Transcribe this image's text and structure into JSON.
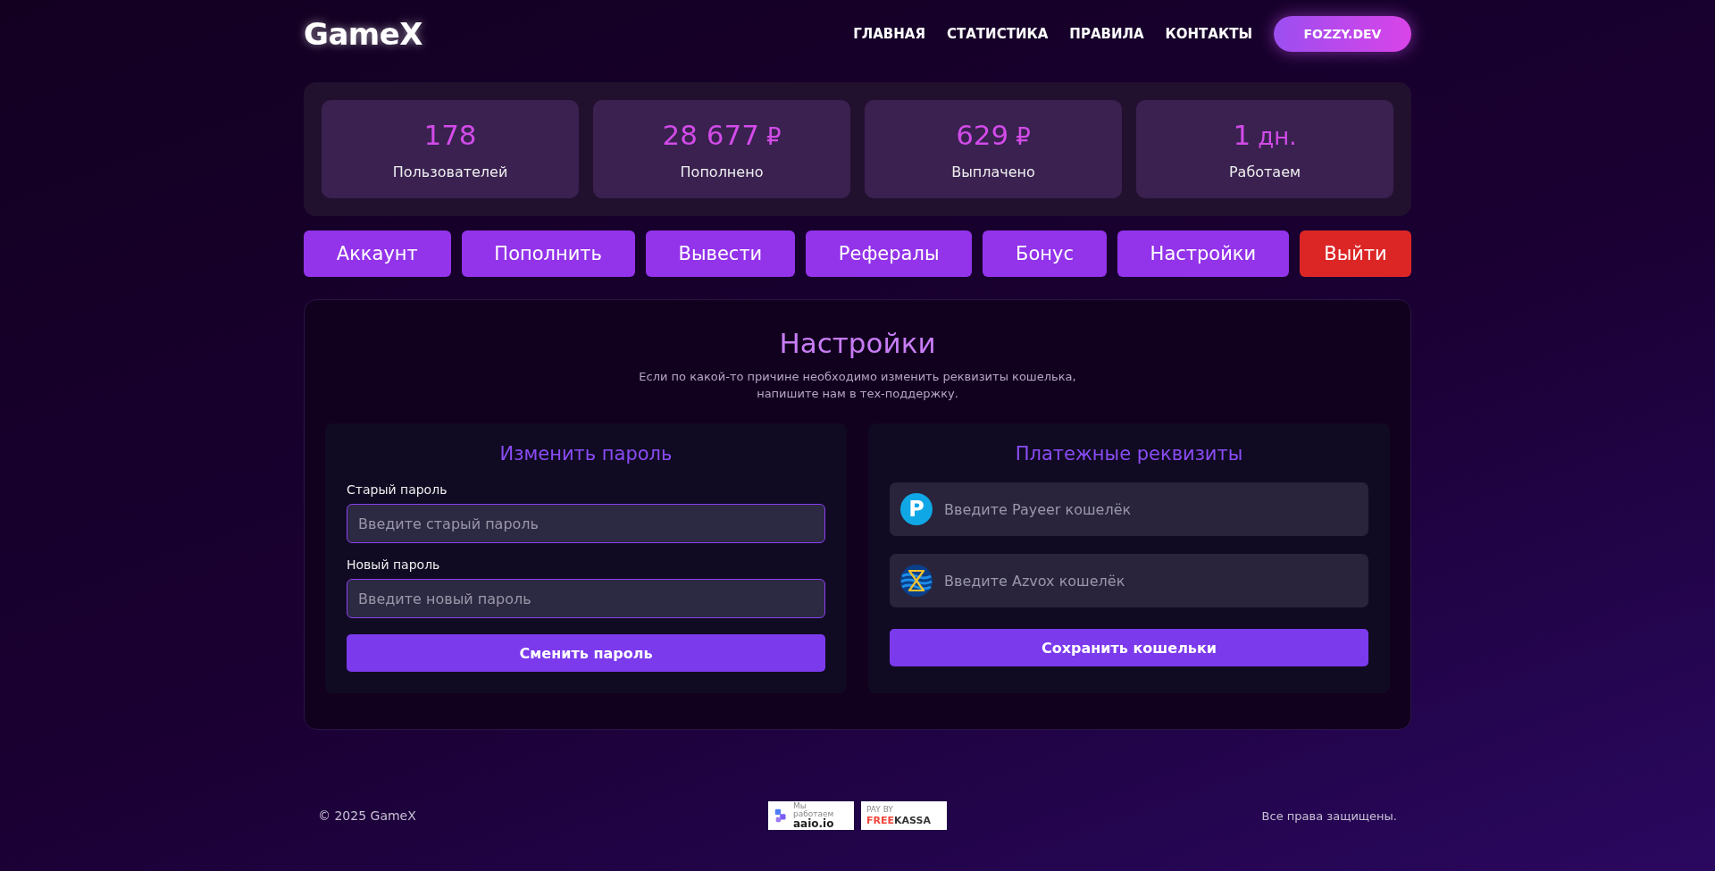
{
  "header": {
    "logo": "GameX",
    "nav": [
      "ГЛАВНАЯ",
      "СТАТИСТИКА",
      "ПРАВИЛА",
      "КОНТАКТЫ"
    ],
    "user_button": "FOZZY.DEV"
  },
  "stats": [
    {
      "value": "178",
      "label": "Пользователей"
    },
    {
      "value": "28 677",
      "unit": "₽",
      "label": "Пополнено"
    },
    {
      "value": "629",
      "unit": "₽",
      "label": "Выплачено"
    },
    {
      "value": "1",
      "unit": "дн.",
      "label": "Работаем"
    }
  ],
  "menu": [
    {
      "label": "Аккаунт",
      "kind": "normal"
    },
    {
      "label": "Пополнить",
      "kind": "normal"
    },
    {
      "label": "Вывести",
      "kind": "normal"
    },
    {
      "label": "Рефералы",
      "kind": "normal"
    },
    {
      "label": "Бонус",
      "kind": "normal"
    },
    {
      "label": "Настройки",
      "kind": "normal"
    },
    {
      "label": "Выйти",
      "kind": "danger"
    }
  ],
  "settings": {
    "title": "Настройки",
    "note": [
      "Если по какой-то причине необходимо изменить реквизиты кошелька,",
      "напишите нам в тех-поддержку."
    ],
    "password": {
      "title": "Изменить пароль",
      "fields": [
        {
          "label": "Старый пароль",
          "placeholder": "Введите старый пароль"
        },
        {
          "label": "Новый пароль",
          "placeholder": "Введите новый пароль"
        }
      ],
      "button": "Сменить пароль"
    },
    "wallets": {
      "title": "Платежные реквизиты",
      "fields": [
        {
          "kind": "payeer",
          "badge": "P",
          "placeholder": "Введите Payeer кошелёк"
        },
        {
          "kind": "azvox",
          "placeholder": "Введите Azvox кошелёк"
        }
      ],
      "button": "Сохранить кошельки"
    }
  },
  "footer": {
    "copyright": "© 2025 GameX",
    "badges": [
      {
        "kind": "aaio",
        "caption": "Мы работаем",
        "name": "aaio.io"
      },
      {
        "kind": "freekassa",
        "caption": "PAY BY",
        "name_a": "FREE",
        "name_b": "KASSA"
      }
    ],
    "rights": "Все права защищены."
  }
}
